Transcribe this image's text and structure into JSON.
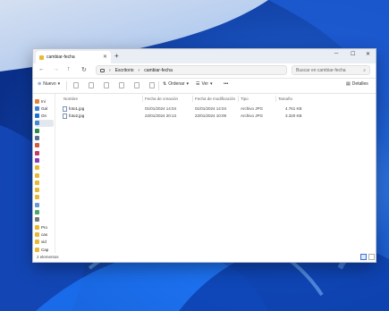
{
  "window": {
    "tab_title": "cambiar-fecha",
    "minimize_glyph": "─",
    "maximize_glyph": "☐",
    "close_glyph": "✕",
    "tab_close_glyph": "✕",
    "new_tab_glyph": "+"
  },
  "nav": {
    "back_glyph": "←",
    "forward_glyph": "→",
    "up_glyph": "↑",
    "refresh_glyph": "↻",
    "chevron_glyph": "›",
    "breadcrumb": [
      "Escritorio",
      "cambiar-fecha"
    ],
    "search_placeholder": "Buscar en cambiar-fecha",
    "search_glyph": "⌕"
  },
  "commandbar": {
    "new_label": "Nuevo",
    "new_glyph": "⊕",
    "sort_label": "Ordenar",
    "sort_glyph": "⇅",
    "view_label": "Ver",
    "view_glyph": "☰",
    "more_glyph": "•••",
    "details_label": "Detalles",
    "details_glyph": "▤",
    "dropdown_glyph": "▾"
  },
  "sidebar": {
    "items": [
      {
        "label": "Ini",
        "icon": "home-icon",
        "color": "#e3833b"
      },
      {
        "label": "Gal",
        "icon": "gallery-icon",
        "color": "#3d7fd6"
      },
      {
        "label": "On",
        "icon": "onedrive-icon",
        "color": "#1f6fd1"
      },
      {
        "label": "",
        "icon": "desktop-icon",
        "color": "#3d8ad6"
      },
      {
        "label": "",
        "icon": "downloads-icon",
        "color": "#2a8a4a"
      },
      {
        "label": "",
        "icon": "documents-icon",
        "color": "#5b6f8c"
      },
      {
        "label": "",
        "icon": "pictures-icon",
        "color": "#d05c3c"
      },
      {
        "label": "",
        "icon": "music-icon",
        "color": "#c03b6c"
      },
      {
        "label": "",
        "icon": "videos-icon",
        "color": "#8a3bc0"
      },
      {
        "label": "",
        "icon": "folder-icon",
        "color": "#e8b936"
      },
      {
        "label": "",
        "icon": "folder-icon",
        "color": "#e8b936"
      },
      {
        "label": "",
        "icon": "folder-icon",
        "color": "#e8b936"
      },
      {
        "label": "",
        "icon": "folder-icon",
        "color": "#e8b936"
      },
      {
        "label": "",
        "icon": "folder-icon",
        "color": "#e8b936"
      },
      {
        "label": "",
        "icon": "app-icon",
        "color": "#6a9ad6"
      },
      {
        "label": "",
        "icon": "app-icon",
        "color": "#4ca86a"
      },
      {
        "label": "",
        "icon": "app-icon",
        "color": "#7a7a7a"
      },
      {
        "label": "Pro",
        "icon": "folder-icon",
        "color": "#e8b936"
      },
      {
        "label": "cas",
        "icon": "folder-icon",
        "color": "#e8b936"
      },
      {
        "label": "vid",
        "icon": "folder-icon",
        "color": "#e8b936"
      },
      {
        "label": "Cap",
        "icon": "folder-icon",
        "color": "#e8b936"
      }
    ],
    "pin_glyph": "📌"
  },
  "table": {
    "columns": [
      "Nombre",
      "Fecha de creación",
      "Fecha de modificación",
      "Tipo",
      "Tamaño"
    ],
    "rows": [
      {
        "name": "foto1.jpg",
        "created": "01/01/2024 14:04",
        "modified": "01/01/2024 14:04",
        "type": "Archivo JPG",
        "size": "4.761 KB"
      },
      {
        "name": "foto2.jpg",
        "created": "22/01/2024 20:13",
        "modified": "22/01/2024 10:09",
        "type": "Archivo JPG",
        "size": "3.320 KB"
      }
    ]
  },
  "status": {
    "count": "2 elementos"
  },
  "colors": {
    "accent": "#3d6fd1",
    "wallpaper": "#0a3fa8"
  }
}
